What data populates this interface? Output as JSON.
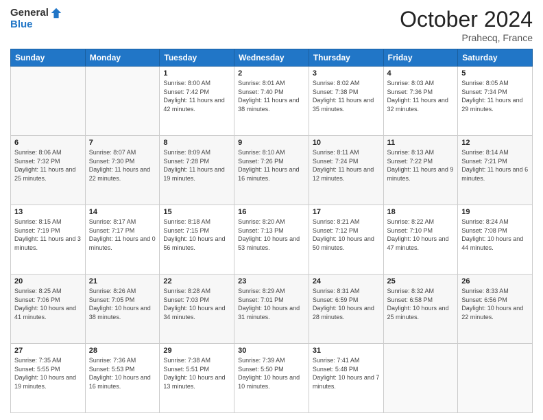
{
  "header": {
    "logo_general": "General",
    "logo_blue": "Blue",
    "month_title": "October 2024",
    "location": "Prahecq, France"
  },
  "days_of_week": [
    "Sunday",
    "Monday",
    "Tuesday",
    "Wednesday",
    "Thursday",
    "Friday",
    "Saturday"
  ],
  "weeks": [
    [
      {
        "day": "",
        "sunrise": "",
        "sunset": "",
        "daylight": ""
      },
      {
        "day": "",
        "sunrise": "",
        "sunset": "",
        "daylight": ""
      },
      {
        "day": "1",
        "sunrise": "Sunrise: 8:00 AM",
        "sunset": "Sunset: 7:42 PM",
        "daylight": "Daylight: 11 hours and 42 minutes."
      },
      {
        "day": "2",
        "sunrise": "Sunrise: 8:01 AM",
        "sunset": "Sunset: 7:40 PM",
        "daylight": "Daylight: 11 hours and 38 minutes."
      },
      {
        "day": "3",
        "sunrise": "Sunrise: 8:02 AM",
        "sunset": "Sunset: 7:38 PM",
        "daylight": "Daylight: 11 hours and 35 minutes."
      },
      {
        "day": "4",
        "sunrise": "Sunrise: 8:03 AM",
        "sunset": "Sunset: 7:36 PM",
        "daylight": "Daylight: 11 hours and 32 minutes."
      },
      {
        "day": "5",
        "sunrise": "Sunrise: 8:05 AM",
        "sunset": "Sunset: 7:34 PM",
        "daylight": "Daylight: 11 hours and 29 minutes."
      }
    ],
    [
      {
        "day": "6",
        "sunrise": "Sunrise: 8:06 AM",
        "sunset": "Sunset: 7:32 PM",
        "daylight": "Daylight: 11 hours and 25 minutes."
      },
      {
        "day": "7",
        "sunrise": "Sunrise: 8:07 AM",
        "sunset": "Sunset: 7:30 PM",
        "daylight": "Daylight: 11 hours and 22 minutes."
      },
      {
        "day": "8",
        "sunrise": "Sunrise: 8:09 AM",
        "sunset": "Sunset: 7:28 PM",
        "daylight": "Daylight: 11 hours and 19 minutes."
      },
      {
        "day": "9",
        "sunrise": "Sunrise: 8:10 AM",
        "sunset": "Sunset: 7:26 PM",
        "daylight": "Daylight: 11 hours and 16 minutes."
      },
      {
        "day": "10",
        "sunrise": "Sunrise: 8:11 AM",
        "sunset": "Sunset: 7:24 PM",
        "daylight": "Daylight: 11 hours and 12 minutes."
      },
      {
        "day": "11",
        "sunrise": "Sunrise: 8:13 AM",
        "sunset": "Sunset: 7:22 PM",
        "daylight": "Daylight: 11 hours and 9 minutes."
      },
      {
        "day": "12",
        "sunrise": "Sunrise: 8:14 AM",
        "sunset": "Sunset: 7:21 PM",
        "daylight": "Daylight: 11 hours and 6 minutes."
      }
    ],
    [
      {
        "day": "13",
        "sunrise": "Sunrise: 8:15 AM",
        "sunset": "Sunset: 7:19 PM",
        "daylight": "Daylight: 11 hours and 3 minutes."
      },
      {
        "day": "14",
        "sunrise": "Sunrise: 8:17 AM",
        "sunset": "Sunset: 7:17 PM",
        "daylight": "Daylight: 11 hours and 0 minutes."
      },
      {
        "day": "15",
        "sunrise": "Sunrise: 8:18 AM",
        "sunset": "Sunset: 7:15 PM",
        "daylight": "Daylight: 10 hours and 56 minutes."
      },
      {
        "day": "16",
        "sunrise": "Sunrise: 8:20 AM",
        "sunset": "Sunset: 7:13 PM",
        "daylight": "Daylight: 10 hours and 53 minutes."
      },
      {
        "day": "17",
        "sunrise": "Sunrise: 8:21 AM",
        "sunset": "Sunset: 7:12 PM",
        "daylight": "Daylight: 10 hours and 50 minutes."
      },
      {
        "day": "18",
        "sunrise": "Sunrise: 8:22 AM",
        "sunset": "Sunset: 7:10 PM",
        "daylight": "Daylight: 10 hours and 47 minutes."
      },
      {
        "day": "19",
        "sunrise": "Sunrise: 8:24 AM",
        "sunset": "Sunset: 7:08 PM",
        "daylight": "Daylight: 10 hours and 44 minutes."
      }
    ],
    [
      {
        "day": "20",
        "sunrise": "Sunrise: 8:25 AM",
        "sunset": "Sunset: 7:06 PM",
        "daylight": "Daylight: 10 hours and 41 minutes."
      },
      {
        "day": "21",
        "sunrise": "Sunrise: 8:26 AM",
        "sunset": "Sunset: 7:05 PM",
        "daylight": "Daylight: 10 hours and 38 minutes."
      },
      {
        "day": "22",
        "sunrise": "Sunrise: 8:28 AM",
        "sunset": "Sunset: 7:03 PM",
        "daylight": "Daylight: 10 hours and 34 minutes."
      },
      {
        "day": "23",
        "sunrise": "Sunrise: 8:29 AM",
        "sunset": "Sunset: 7:01 PM",
        "daylight": "Daylight: 10 hours and 31 minutes."
      },
      {
        "day": "24",
        "sunrise": "Sunrise: 8:31 AM",
        "sunset": "Sunset: 6:59 PM",
        "daylight": "Daylight: 10 hours and 28 minutes."
      },
      {
        "day": "25",
        "sunrise": "Sunrise: 8:32 AM",
        "sunset": "Sunset: 6:58 PM",
        "daylight": "Daylight: 10 hours and 25 minutes."
      },
      {
        "day": "26",
        "sunrise": "Sunrise: 8:33 AM",
        "sunset": "Sunset: 6:56 PM",
        "daylight": "Daylight: 10 hours and 22 minutes."
      }
    ],
    [
      {
        "day": "27",
        "sunrise": "Sunrise: 7:35 AM",
        "sunset": "Sunset: 5:55 PM",
        "daylight": "Daylight: 10 hours and 19 minutes."
      },
      {
        "day": "28",
        "sunrise": "Sunrise: 7:36 AM",
        "sunset": "Sunset: 5:53 PM",
        "daylight": "Daylight: 10 hours and 16 minutes."
      },
      {
        "day": "29",
        "sunrise": "Sunrise: 7:38 AM",
        "sunset": "Sunset: 5:51 PM",
        "daylight": "Daylight: 10 hours and 13 minutes."
      },
      {
        "day": "30",
        "sunrise": "Sunrise: 7:39 AM",
        "sunset": "Sunset: 5:50 PM",
        "daylight": "Daylight: 10 hours and 10 minutes."
      },
      {
        "day": "31",
        "sunrise": "Sunrise: 7:41 AM",
        "sunset": "Sunset: 5:48 PM",
        "daylight": "Daylight: 10 hours and 7 minutes."
      },
      {
        "day": "",
        "sunrise": "",
        "sunset": "",
        "daylight": ""
      },
      {
        "day": "",
        "sunrise": "",
        "sunset": "",
        "daylight": ""
      }
    ]
  ]
}
